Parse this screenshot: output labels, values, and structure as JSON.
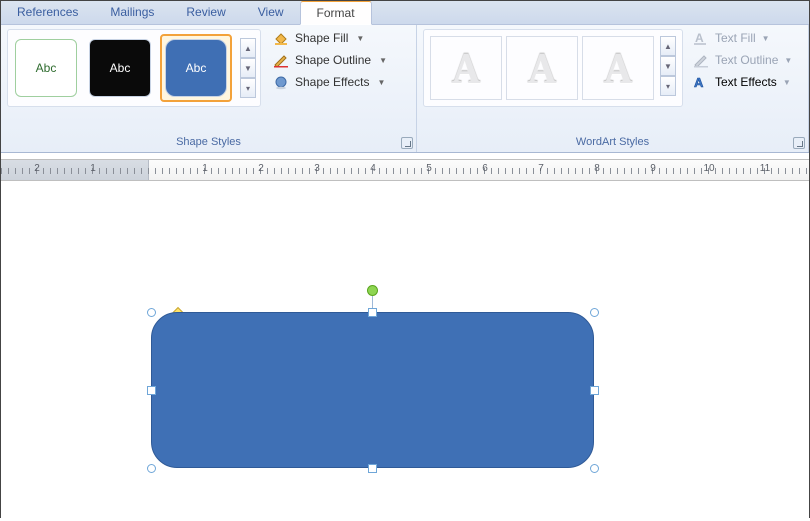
{
  "tabs": {
    "references": "References",
    "mailings": "Mailings",
    "review": "Review",
    "view": "View",
    "format": "Format"
  },
  "shapeStyles": {
    "groupLabel": "Shape Styles",
    "sample": "Abc",
    "fill": "Shape Fill",
    "outline": "Shape Outline",
    "effects": "Shape Effects"
  },
  "wordart": {
    "groupLabel": "WordArt Styles",
    "glyph": "A",
    "textFill": "Text Fill",
    "textOutline": "Text Outline",
    "textEffects": "Text Effects"
  },
  "ruler": {
    "numbers": [
      "2",
      "1",
      "1",
      "2",
      "3",
      "4",
      "5",
      "6",
      "7",
      "8",
      "9",
      "10",
      "11"
    ]
  }
}
